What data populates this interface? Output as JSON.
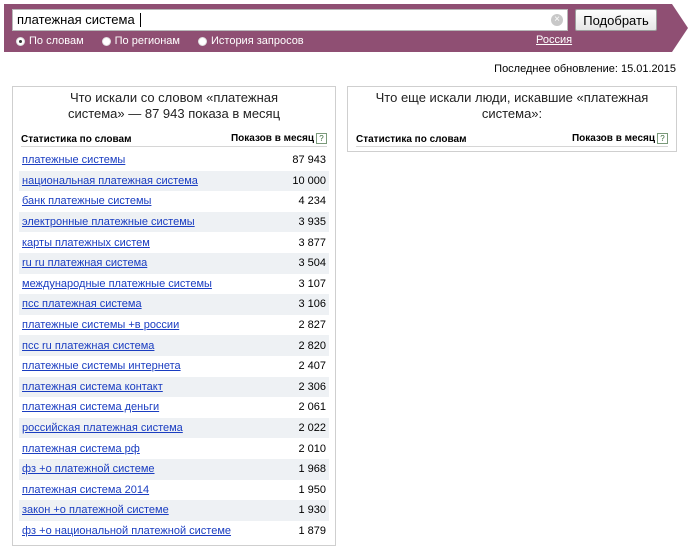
{
  "search": {
    "value": "платежная система",
    "submit_label": "Подобрать"
  },
  "mode_options": [
    {
      "label": "По словам",
      "checked": true
    },
    {
      "label": "По регионам",
      "checked": false
    },
    {
      "label": "История запросов",
      "checked": false
    }
  ],
  "region": "Россия",
  "last_update": "Последнее обновление: 15.01.2015",
  "left_panel": {
    "title_line1": "Что искали со словом «платежная",
    "title_line2": "система» — 87 943 показа в месяц",
    "col_query": "Статистика по словам",
    "col_count": "Показов в месяц",
    "help": "?",
    "rows": [
      {
        "query": "платежные системы",
        "count": "87 943"
      },
      {
        "query": "национальная платежная система",
        "count": "10 000"
      },
      {
        "query": "банк платежные системы",
        "count": "4 234"
      },
      {
        "query": "электронные платежные системы",
        "count": "3 935"
      },
      {
        "query": "карты платежных систем",
        "count": "3 877"
      },
      {
        "query": "ru ru платежная система",
        "count": "3 504"
      },
      {
        "query": "международные платежные системы",
        "count": "3 107"
      },
      {
        "query": "пcс платежная система",
        "count": "3 106"
      },
      {
        "query": "платежные системы +в россии",
        "count": "2 827"
      },
      {
        "query": "пcс ru платежная система",
        "count": "2 820"
      },
      {
        "query": "платежные системы интернета",
        "count": "2 407"
      },
      {
        "query": "платежная система контакт",
        "count": "2 306"
      },
      {
        "query": "платежная система деньги",
        "count": "2 061"
      },
      {
        "query": "российская платежная система",
        "count": "2 022"
      },
      {
        "query": "платежная система рф",
        "count": "2 010"
      },
      {
        "query": "фз +о платежной системе",
        "count": "1 968"
      },
      {
        "query": "платежная система 2014",
        "count": "1 950"
      },
      {
        "query": "закон +о платежной системе",
        "count": "1 930"
      },
      {
        "query": "фз +о национальной платежной системе",
        "count": "1 879"
      }
    ]
  },
  "right_panel": {
    "title_line1": "Что еще искали люди, искавшие «платежная",
    "title_line2": "система»:",
    "col_query": "Статистика по словам",
    "col_count": "Показов в месяц",
    "help": "?"
  },
  "colors": {
    "header_band": "#8f4f73",
    "link": "#1a3dc1",
    "row_stripe": "#eef1f4"
  }
}
